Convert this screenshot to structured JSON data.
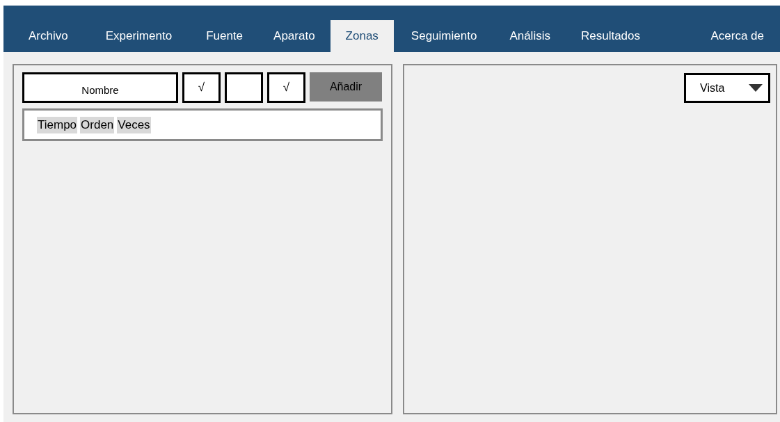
{
  "tabs": [
    {
      "label": "Archivo",
      "selected": false
    },
    {
      "label": "Experimento",
      "selected": false
    },
    {
      "label": "Fuente",
      "selected": false
    },
    {
      "label": "Aparato",
      "selected": false
    },
    {
      "label": "Zonas",
      "selected": true
    },
    {
      "label": "Seguimiento",
      "selected": false
    },
    {
      "label": "Análisis",
      "selected": false
    },
    {
      "label": "Resultados",
      "selected": false
    },
    {
      "label": "Acerca de",
      "selected": false
    }
  ],
  "zone_editor": {
    "name_field": {
      "value": "Nombre"
    },
    "check_glyph": "√",
    "checkboxes": [
      {
        "checked": true
      },
      {
        "checked": false
      },
      {
        "checked": true
      }
    ],
    "add_button": "Añadir",
    "columns": [
      "Tiempo",
      "Orden",
      "Veces"
    ]
  },
  "view_panel": {
    "dropdown": {
      "value": "Vista"
    }
  }
}
